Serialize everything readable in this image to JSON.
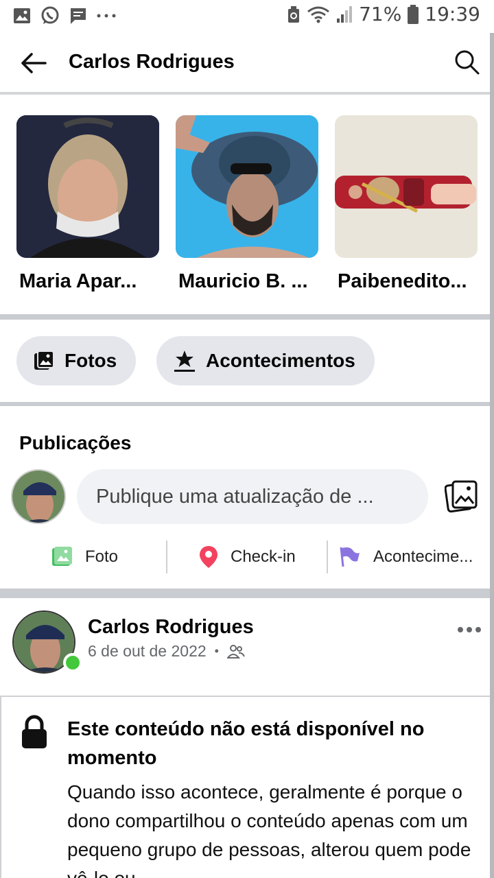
{
  "status_bar": {
    "battery": "71%",
    "time": "19:39",
    "icons": [
      "gallery-icon",
      "whatsapp-icon",
      "message-icon",
      "more-notifications-icon",
      "recycle-icon",
      "wifi-icon",
      "signal-icon",
      "battery-icon"
    ]
  },
  "header": {
    "title": "Carlos Rodrigues"
  },
  "friends": [
    {
      "name": "Maria Apar..."
    },
    {
      "name": "Mauricio B. ..."
    },
    {
      "name": "Paibenedito..."
    }
  ],
  "chips": {
    "photos": "Fotos",
    "events": "Acontecimentos"
  },
  "publications": {
    "title": "Publicações",
    "composer_placeholder": "Publique uma atualização de ...",
    "actions": {
      "photo": "Foto",
      "checkin": "Check-in",
      "event": "Acontecime..."
    }
  },
  "post": {
    "author": "Carlos Rodrigues",
    "date": "6 de out de 2022",
    "notice_title": "Este conteúdo não está disponível no momento",
    "notice_body": "Quando isso acontece, geralmente é porque o dono compartilhou o conteúdo apenas com um pequeno grupo de pessoas, alterou quem pode vê-lo ou"
  },
  "colors": {
    "separator": "#c9ccd1",
    "chip_bg": "#e4e6eb",
    "composer_bg": "#f0f2f5",
    "online": "#42c83a",
    "photo_green": "#45bd62",
    "checkin_red": "#f3425f",
    "event_purple": "#8c74e0"
  }
}
